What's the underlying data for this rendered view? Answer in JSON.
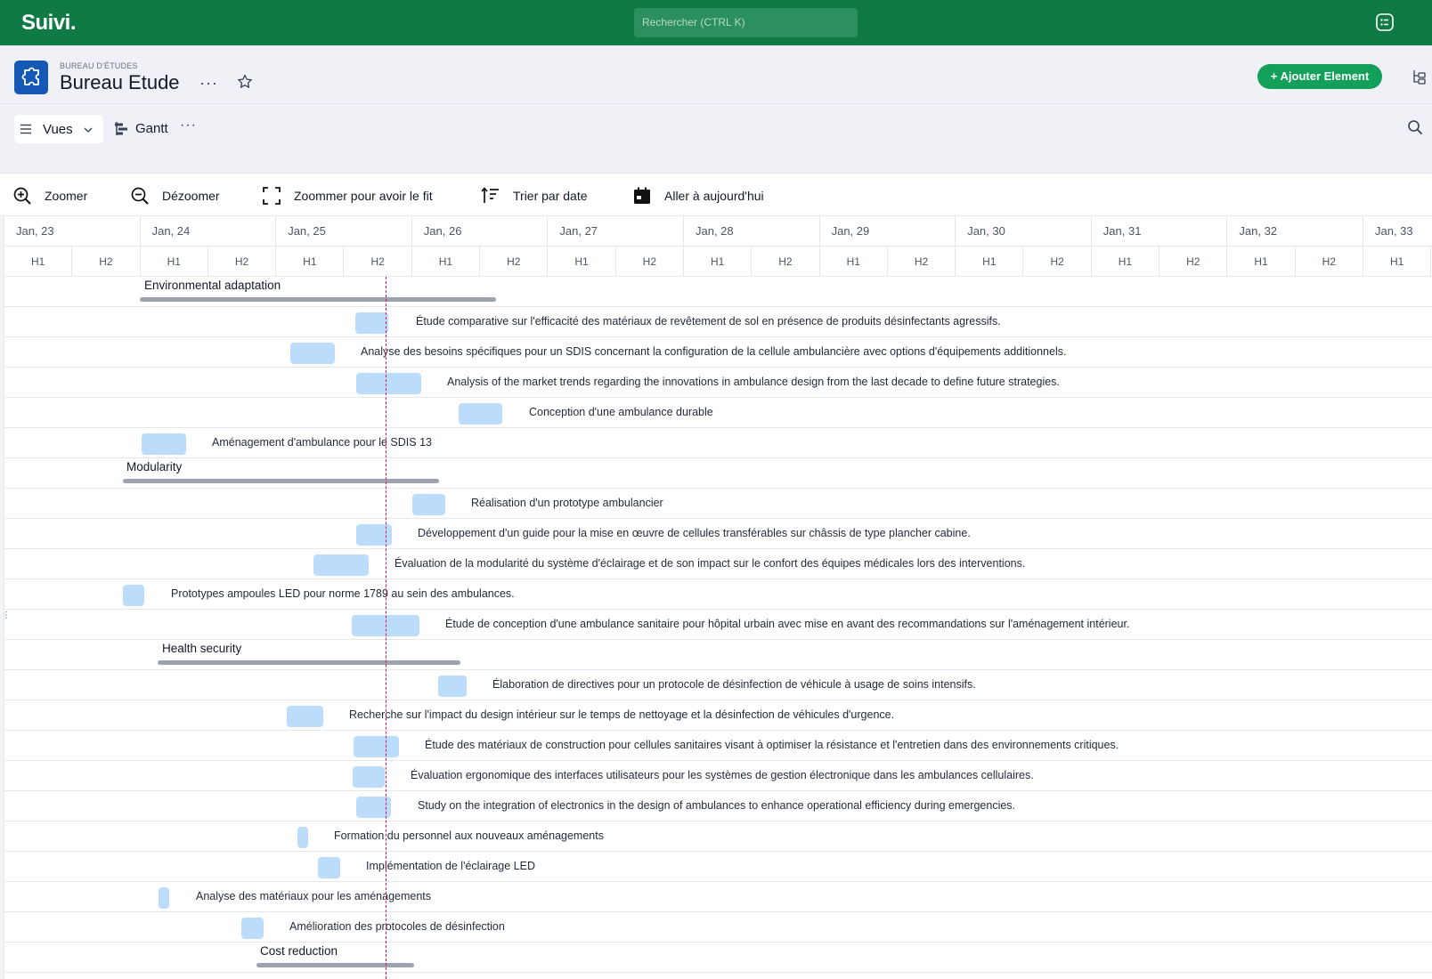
{
  "app": {
    "logo": "Suivi."
  },
  "search": {
    "placeholder": "Rechercher (CTRL K)"
  },
  "header": {
    "breadcrumb": "BUREAU D'ÉTUDES",
    "title": "Bureau Etude",
    "more": "···",
    "add_button": "+ Ajouter Element"
  },
  "views": {
    "label": "Vues",
    "current_view": "Gantt",
    "more": "···"
  },
  "toolbar": {
    "zoom_in": "Zoomer",
    "zoom_out": "Dézoomer",
    "zoom_fit": "Zoommer pour avoir le fit",
    "sort_date": "Trier par date",
    "go_today": "Aller à aujourd'hui"
  },
  "timeline": {
    "days": [
      "Jan, 23",
      "Jan, 24",
      "Jan, 25",
      "Jan, 26",
      "Jan, 27",
      "Jan, 28",
      "Jan, 29",
      "Jan, 30",
      "Jan, 31",
      "Jan, 32",
      "Jan, 33"
    ],
    "halves": [
      "H1",
      "H2"
    ]
  },
  "gantt": {
    "groups": [
      {
        "name": "Environmental adaptation",
        "tasks": [
          "Étude comparative sur l'efficacité des matériaux de revêtement de sol en présence de produits désinfectants agressifs.",
          "Analyse des besoins spécifiques pour un SDIS concernant la configuration de la cellule ambulancière avec options d'équipements additionnels.",
          "Analysis of the market trends regarding the innovations in ambulance design from the last decade to define future strategies.",
          "Conception d'une ambulance durable",
          "Aménagement d'ambulance pour le SDIS 13"
        ]
      },
      {
        "name": "Modularity",
        "tasks": [
          "Réalisation d'un prototype ambulancier",
          "Développement d'un guide pour la mise en œuvre de cellules transférables sur châssis de type plancher cabine.",
          "Évaluation de la modularité du système d'éclairage et de son impact sur le confort des équipes médicales lors des interventions.",
          "Prototypes ampoules LED pour norme 1789 au sein des ambulances.",
          "Étude de conception d'une ambulance sanitaire pour hôpital urbain avec mise en avant des recommandations sur l'aménagement intérieur."
        ]
      },
      {
        "name": "Health security",
        "tasks": [
          "Élaboration de directives pour un protocole de désinfection de véhicule à usage de soins intensifs.",
          "Recherche sur l'impact du design intérieur sur le temps de nettoyage et la désinfection de véhicules d'urgence.",
          "Étude des matériaux de construction pour cellules sanitaires visant à optimiser la résistance et l'entretien dans des environnements critiques.",
          "Évaluation ergonomique des interfaces utilisateurs pour les systèmes de gestion électronique dans les ambulances cellulaires.",
          "Study on the integration of electronics in the design of ambulances to enhance operational efficiency during emergencies.",
          "Formation du personnel aux nouveaux aménagements",
          "Implémentation de l'éclairage LED",
          "Analyse des matériaux pour les aménagements",
          "Amélioration des protocoles de désinfection"
        ]
      },
      {
        "name": "Cost reduction",
        "tasks": []
      }
    ]
  },
  "colors": {
    "brand": "#0f7a46",
    "accent": "#12a05a",
    "bar": "#bcdcfb",
    "project_icon": "#1558b6",
    "today_line": "#e0115f"
  }
}
